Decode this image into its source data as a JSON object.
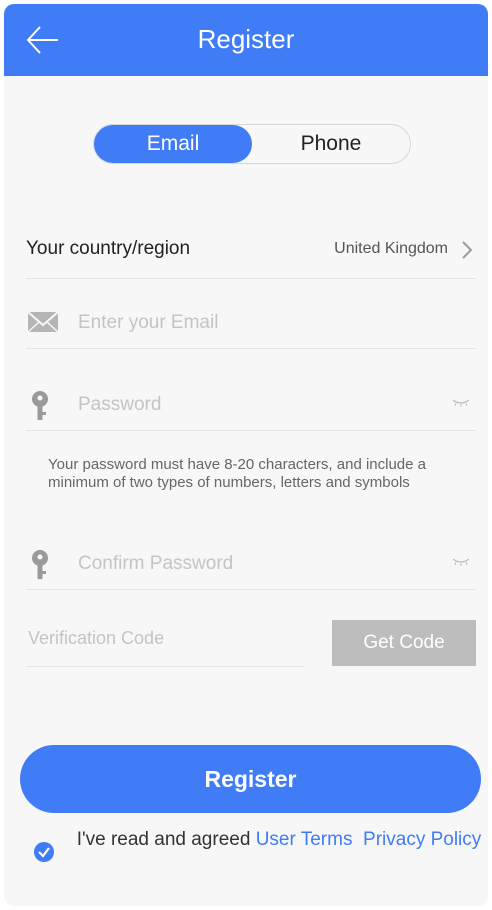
{
  "header": {
    "title": "Register",
    "back_icon": "arrow-left-icon"
  },
  "tabs": {
    "email_label": "Email",
    "phone_label": "Phone",
    "selected": "Email"
  },
  "country": {
    "label": "Your country/region",
    "value": "United Kingdom",
    "icon": "chevron-right-icon"
  },
  "email": {
    "placeholder": "Enter your Email",
    "value": "",
    "icon": "envelope-icon"
  },
  "password": {
    "placeholder": "Password",
    "value": "",
    "icon": "key-icon",
    "toggle_icon": "eye-closed-icon"
  },
  "password_hint": "Your password must have 8-20 characters, and include a minimum of two types of numbers, letters and symbols",
  "confirm_password": {
    "placeholder": "Confirm Password",
    "value": "",
    "icon": "key-icon",
    "toggle_icon": "eye-closed-icon"
  },
  "verification": {
    "placeholder": "Verification Code",
    "value": "",
    "button_label": "Get Code"
  },
  "register_button": "Register",
  "agreement": {
    "checked": true,
    "prefix": "I've read and agreed",
    "terms_label": "User Terms",
    "privacy_label": "Privacy Policy"
  },
  "colors": {
    "accent": "#3f7cf5",
    "disabled_button": "#bdbdbd",
    "background": "#f7f7f7"
  }
}
